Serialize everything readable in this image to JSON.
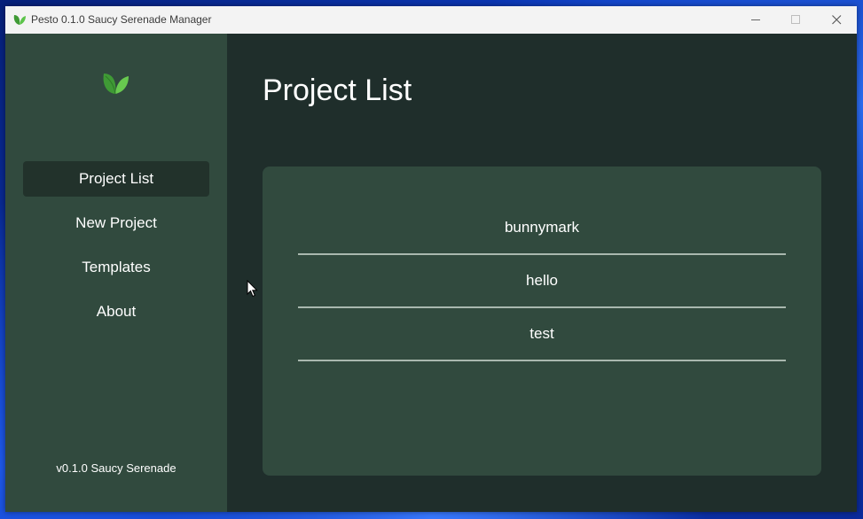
{
  "window": {
    "title": "Pesto 0.1.0 Saucy Serenade Manager",
    "controls": {
      "minimize": "—",
      "maximize": "☐",
      "close": "✕"
    }
  },
  "sidebar": {
    "items": [
      {
        "label": "Project List",
        "active": true
      },
      {
        "label": "New Project",
        "active": false
      },
      {
        "label": "Templates",
        "active": false
      },
      {
        "label": "About",
        "active": false
      }
    ],
    "version": "v0.1.0 Saucy Serenade"
  },
  "main": {
    "title": "Project List",
    "projects": [
      "bunnymark",
      "hello",
      "test"
    ]
  },
  "colors": {
    "sidebar_bg": "#314a3e",
    "main_bg": "#1f2e2b",
    "active_item_bg": "#22322b",
    "panel_bg": "#314a3e",
    "divider": "#a9b8ae",
    "leaf_green": "#4caf3f"
  },
  "icons": {
    "app": "leaf-icon",
    "logo": "leaf-icon",
    "cursor": "mouse-pointer-icon"
  }
}
